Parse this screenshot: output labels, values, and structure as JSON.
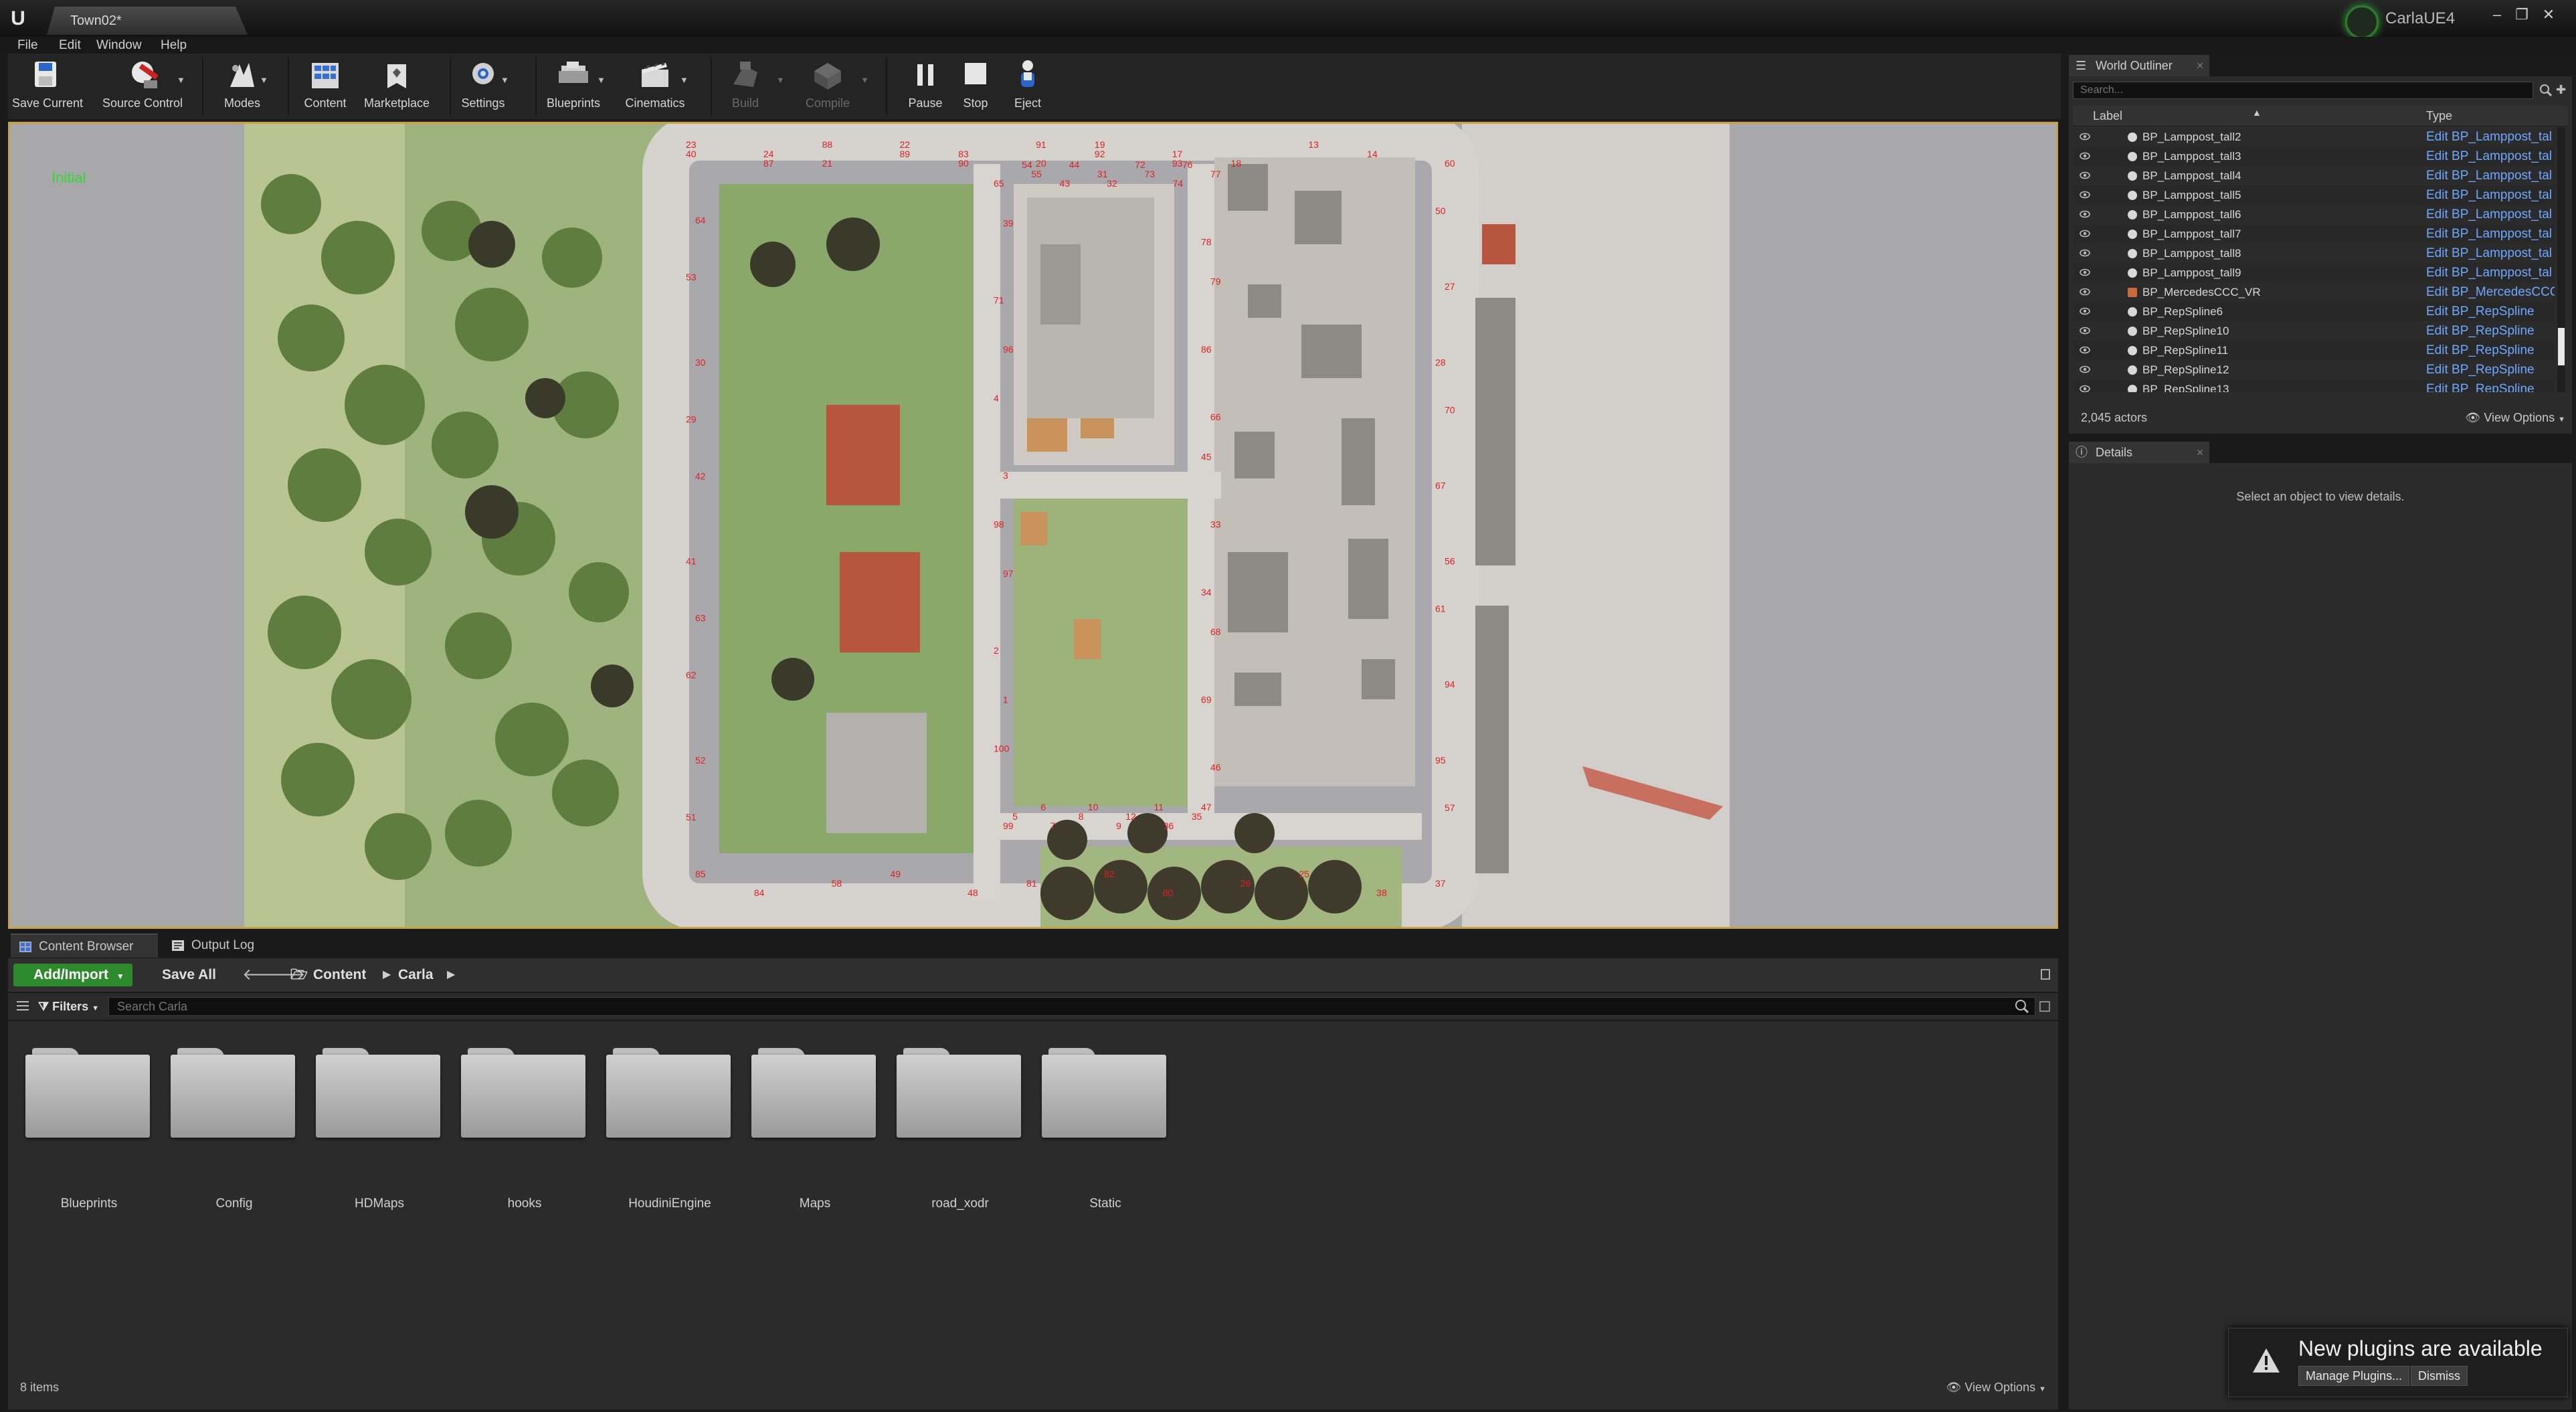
{
  "window": {
    "document_tab": "Town02*",
    "project_name": "CarlaUE4"
  },
  "menu": [
    "File",
    "Edit",
    "Window",
    "Help"
  ],
  "toolbar": {
    "save_current": "Save Current",
    "source_control": "Source Control",
    "modes": "Modes",
    "content": "Content",
    "marketplace": "Marketplace",
    "settings": "Settings",
    "blueprints": "Blueprints",
    "cinematics": "Cinematics",
    "build": "Build",
    "compile": "Compile",
    "pause": "Pause",
    "stop": "Stop",
    "eject": "Eject"
  },
  "viewport": {
    "label": "Initial",
    "spawn_numbers": [
      "23",
      "24",
      "21",
      "22",
      "83",
      "20",
      "19",
      "17",
      "18",
      "13",
      "14",
      "60",
      "50",
      "27",
      "28",
      "70",
      "67",
      "56",
      "61",
      "94",
      "95",
      "57",
      "37",
      "38",
      "25",
      "26",
      "80",
      "82",
      "81",
      "48",
      "49",
      "58",
      "84",
      "85",
      "51",
      "52",
      "62",
      "63",
      "41",
      "42",
      "29",
      "30",
      "53",
      "64",
      "65",
      "54",
      "55",
      "43",
      "44",
      "31",
      "32",
      "72",
      "73",
      "74",
      "76",
      "77",
      "78",
      "79",
      "86",
      "66",
      "45",
      "33",
      "34",
      "68",
      "69",
      "46",
      "47",
      "35",
      "36",
      "11",
      "12",
      "9",
      "10",
      "8",
      "7",
      "6",
      "5",
      "99",
      "100",
      "1",
      "2",
      "97",
      "98",
      "3",
      "4",
      "96",
      "71",
      "39",
      "40",
      "87",
      "88",
      "89",
      "90",
      "91",
      "92",
      "93"
    ]
  },
  "bottom_tabs": {
    "content_browser": "Content Browser",
    "output_log": "Output Log"
  },
  "content_browser": {
    "add_import": "Add/Import",
    "save_all": "Save All",
    "breadcrumb": [
      "Content",
      "Carla"
    ],
    "filters": "Filters",
    "search_placeholder": "Search Carla",
    "folders": [
      "Blueprints",
      "Config",
      "HDMaps",
      "hooks",
      "HoudiniEngine",
      "Maps",
      "road_xodr",
      "Static"
    ],
    "item_count": "8 items",
    "view_options": "View Options"
  },
  "world_outliner": {
    "title": "World Outliner",
    "search_placeholder": "Search...",
    "col_label": "Label",
    "col_type": "Type",
    "rows": [
      {
        "label": "BP_Lamppost_tall2",
        "type": "Edit BP_Lamppost_tal"
      },
      {
        "label": "BP_Lamppost_tall3",
        "type": "Edit BP_Lamppost_tal"
      },
      {
        "label": "BP_Lamppost_tall4",
        "type": "Edit BP_Lamppost_tal"
      },
      {
        "label": "BP_Lamppost_tall5",
        "type": "Edit BP_Lamppost_tal"
      },
      {
        "label": "BP_Lamppost_tall6",
        "type": "Edit BP_Lamppost_tal"
      },
      {
        "label": "BP_Lamppost_tall7",
        "type": "Edit BP_Lamppost_tal"
      },
      {
        "label": "BP_Lamppost_tall8",
        "type": "Edit BP_Lamppost_tal"
      },
      {
        "label": "BP_Lamppost_tall9",
        "type": "Edit BP_Lamppost_tal"
      },
      {
        "label": "BP_MercedesCCC_VR",
        "type": "Edit BP_MercedesCCC"
      },
      {
        "label": "BP_RepSpline6",
        "type": "Edit BP_RepSpline"
      },
      {
        "label": "BP_RepSpline10",
        "type": "Edit BP_RepSpline"
      },
      {
        "label": "BP_RepSpline11",
        "type": "Edit BP_RepSpline"
      },
      {
        "label": "BP_RepSpline12",
        "type": "Edit BP_RepSpline"
      },
      {
        "label": "BP_RepSpline13",
        "type": "Edit BP_RepSpline"
      }
    ],
    "actor_count": "2,045 actors",
    "view_options": "View Options"
  },
  "details": {
    "title": "Details",
    "empty_message": "Select an object to view details."
  },
  "notification": {
    "title": "New plugins are available",
    "manage": "Manage Plugins...",
    "dismiss": "Dismiss"
  },
  "icons": [
    "ue-logo",
    "save-icon",
    "source-control-icon",
    "modes-icon",
    "content-icon",
    "marketplace-icon",
    "settings-icon",
    "blueprints-icon",
    "cinematics-icon",
    "build-icon",
    "compile-icon",
    "pause-icon",
    "stop-icon",
    "eject-icon",
    "eye-icon",
    "warning-icon",
    "search-icon",
    "folder-icon"
  ]
}
